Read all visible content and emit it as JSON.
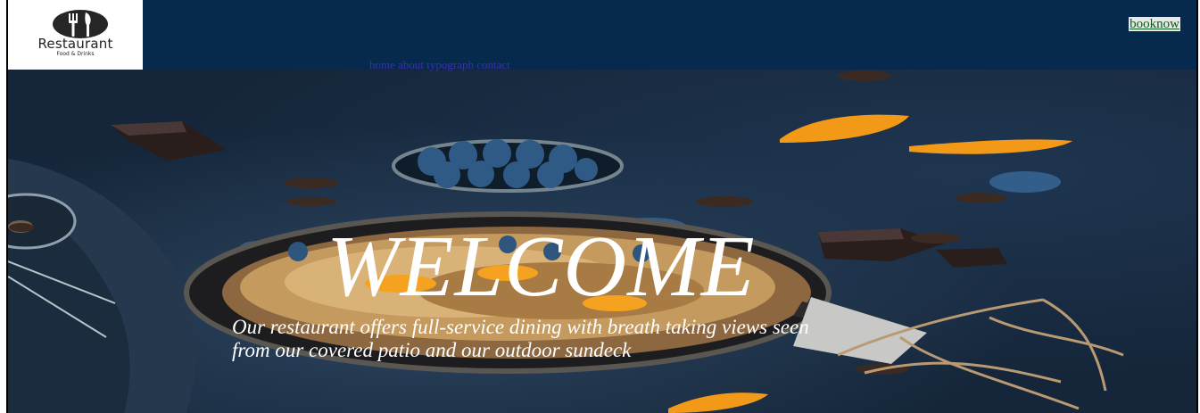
{
  "logo": {
    "name": "Restaurant",
    "tagline": "Food & Drinks",
    "icon": "fork-knife-plate-icon"
  },
  "booking": {
    "label": "booknow"
  },
  "nav": {
    "items": [
      "home",
      "about",
      "typograph",
      "contact"
    ]
  },
  "hero": {
    "title": "WELCOME",
    "description": "Our restaurant offers full-service dining with breath taking views seen from our covered patio and our outdoor sundeck",
    "image": "dark-food-table-photo"
  },
  "colors": {
    "header": "#062a4e",
    "booknow_text": "#0a5a1a",
    "nav_text": "#3d2bb8",
    "hero_text": "#ffffff"
  }
}
